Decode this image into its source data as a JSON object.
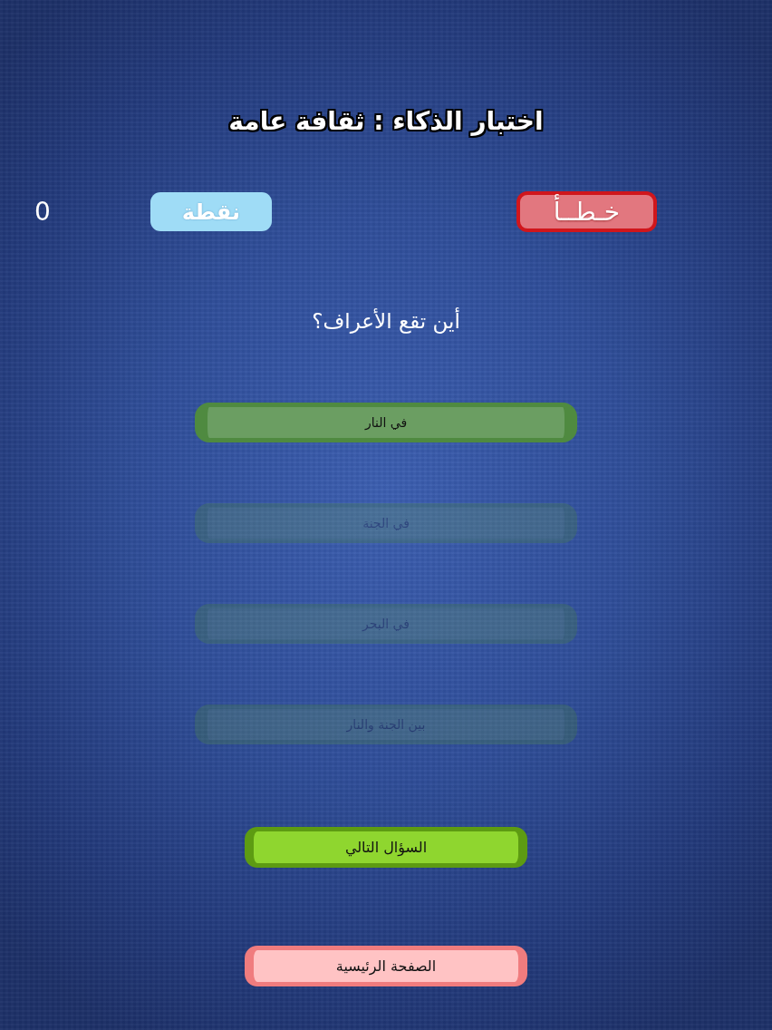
{
  "title": "اختبار الذكاء : ثقافة عامة",
  "score": {
    "value": "0",
    "label": "نقطة"
  },
  "result": {
    "kind": "wrong",
    "label": "خـطــأ"
  },
  "question": "أين تقع الأعراف؟",
  "answers": [
    {
      "label": "في النار",
      "disabled": false
    },
    {
      "label": "في الجنة",
      "disabled": true
    },
    {
      "label": "في البحر",
      "disabled": true
    },
    {
      "label": "بين الجنة والنار",
      "disabled": true
    }
  ],
  "buttons": [
    {
      "kind": "next",
      "label": "السؤال التالي"
    },
    {
      "kind": "home",
      "label": "الصفحة الرئيسية"
    }
  ]
}
